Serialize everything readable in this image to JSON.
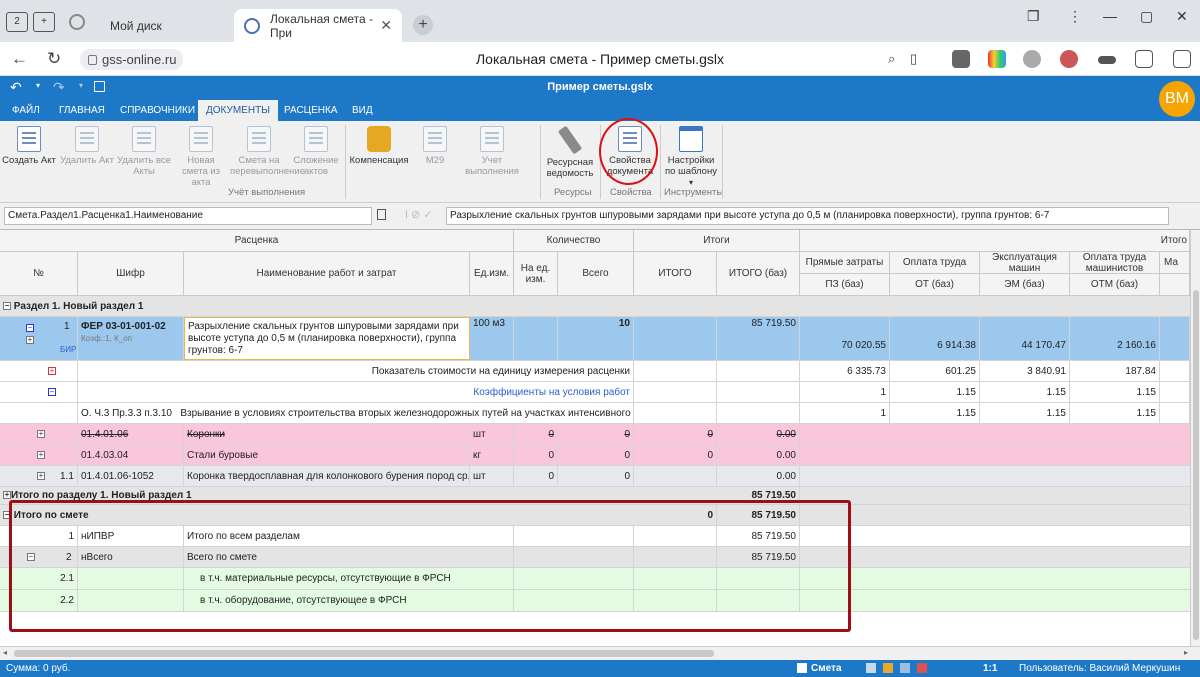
{
  "browser": {
    "tab_badge": "2",
    "tab_inactive": "Мой диск",
    "tab_active": "Локальная смета - При",
    "url": "gss-online.ru",
    "page_title": "Локальная смета - Пример сметы.gslx"
  },
  "app": {
    "title": "Пример сметы.gslx",
    "avatar": "ВМ",
    "tabs": [
      "ФАЙЛ",
      "ГЛАВНАЯ",
      "СПРАВОЧНИКИ",
      "ДОКУМЕНТЫ",
      "РАСЦЕНКА",
      "ВИД"
    ],
    "active_tab": "ДОКУМЕНТЫ"
  },
  "ribbon": {
    "buttons": [
      {
        "label": "Создать Акт",
        "enabled": true
      },
      {
        "label": "Удалить Акт",
        "enabled": false
      },
      {
        "label": "Удалить все Акты",
        "enabled": false
      },
      {
        "label": "Новая смета из акта",
        "enabled": false
      },
      {
        "label": "Смета на перевыполнение",
        "enabled": false
      },
      {
        "label": "Сложение актов",
        "enabled": false
      },
      {
        "label": "Компенсация",
        "enabled": true
      },
      {
        "label": "М29",
        "enabled": false
      },
      {
        "label": "Учет выполнения",
        "enabled": false
      },
      {
        "label": "Ресурсная ведомость",
        "enabled": true
      },
      {
        "label": "Свойства документа",
        "enabled": true
      },
      {
        "label": "Настройки по шаблону",
        "enabled": true
      }
    ],
    "groups": [
      "Учёт выполнения",
      "Ресурсы",
      "Свойства",
      "Инструменты"
    ]
  },
  "formula": {
    "path": "Смета.Раздел1.Расценка1.Наименование",
    "value": "Разрыхление скальных грунтов шпуровыми зарядами при высоте уступа до 0,5 м (планировка поверхности), группа грунтов: 6-7"
  },
  "grid": {
    "header": {
      "group_rascenka": "Расценка",
      "group_qty": "Количество",
      "group_itogi": "Итоги",
      "group_itogo_right": "Итого",
      "num": "№",
      "code": "Шифр",
      "name": "Наименование работ и затрат",
      "unit": "Ед.изм.",
      "per_unit": "На ед. изм.",
      "total": "Всего",
      "itogo": "ИТОГО",
      "itogo_baz": "ИТОГО (баз)",
      "pz": "Прямые затраты",
      "ot": "Оплата труда",
      "em": "Эксплуатация машин",
      "otm": "Оплата труда машинистов",
      "ma": "Ма",
      "pz2": "ПЗ (баз)",
      "ot2": "ОТ (баз)",
      "em2": "ЭМ (баз)",
      "otm2": "ОТМ (баз)"
    },
    "section1": "Раздел 1. Новый раздел 1",
    "pos1": {
      "num": "1",
      "code": "ФЕР 03-01-001-02",
      "coef": "Коэф.:1, К_оп",
      "bir": "БИР",
      "name": "Разрыхление скальных грунтов шпуровыми зарядами при высоте уступа до 0,5 м (планировка поверхности), группа грунтов: 6-7",
      "unit": "100 м3",
      "total": "10",
      "itogo_baz": "85 719.50",
      "pz": "70 020.55",
      "ot": "6 914.38",
      "em": "44 170.47",
      "otm": "2 160.16"
    },
    "indicator": {
      "label": "Показатель стоимости на единицу измерения расценки",
      "pz": "6 335.73",
      "ot": "601.25",
      "em": "3 840.91",
      "otm": "187.84"
    },
    "coeffs": {
      "label": "Коэффициенты на условия работ",
      "pz": "1",
      "ot": "1.15",
      "em": "1.15",
      "otm": "1.15"
    },
    "coef_row": {
      "code": "О. Ч.3 Пр.3.3 п.3.10",
      "name": "Взрывание в условиях строительства вторых железнодорожных путей на участках интенсивного дв...",
      "pz": "1",
      "ot": "1.15",
      "em": "1.15",
      "otm": "1.15"
    },
    "res1": {
      "code": "01.4.01.06",
      "name": "Коронки",
      "unit": "шт",
      "per_unit": "0",
      "total": "0",
      "itogo": "0",
      "itogo_baz": "0.00"
    },
    "res2": {
      "code": "01.4.03.04",
      "name": "Стали буровые",
      "unit": "кг",
      "per_unit": "0",
      "total": "0",
      "itogo": "0",
      "itogo_baz": "0.00"
    },
    "res3": {
      "num": "1.1",
      "code": "01.4.01.06-1052",
      "name": "Коронка твердосплавная для колонкового бурения пород ср...",
      "unit": "шт",
      "per_unit": "0",
      "total": "0",
      "itogo_baz": "0.00"
    },
    "section_total": {
      "label": "Итого по разделу 1. Новый раздел 1",
      "itogo_baz": "85 719.50"
    },
    "estimate_total": {
      "label": "Итого по смете",
      "itogo": "0",
      "itogo_baz": "85 719.50"
    },
    "t1": {
      "num": "1",
      "code": "нИПВР",
      "name": "Итого по всем разделам",
      "itogo_baz": "85 719.50"
    },
    "t2": {
      "num": "2",
      "code": "нВсего",
      "name": "Всего по смете",
      "itogo_baz": "85 719.50"
    },
    "t21": {
      "num": "2.1",
      "name": "в т.ч. материальные ресурсы, отсутствующие в ФРСН"
    },
    "t22": {
      "num": "2.2",
      "name": "в т.ч. оборудование, отсутствующее в ФРСН"
    }
  },
  "status": {
    "sum": "Сумма: 0 руб.",
    "mode": "Смета",
    "scale": "1:1",
    "user": "Пользователь: Василий Меркушин"
  },
  "colors": {
    "accent": "#1e78c8",
    "row_selected": "#9cc8ee",
    "row_pink": "#f9c6dc",
    "row_grey": "#e4e4e4",
    "row_green": "#e3fbe0",
    "annotation": "#a10d16"
  }
}
